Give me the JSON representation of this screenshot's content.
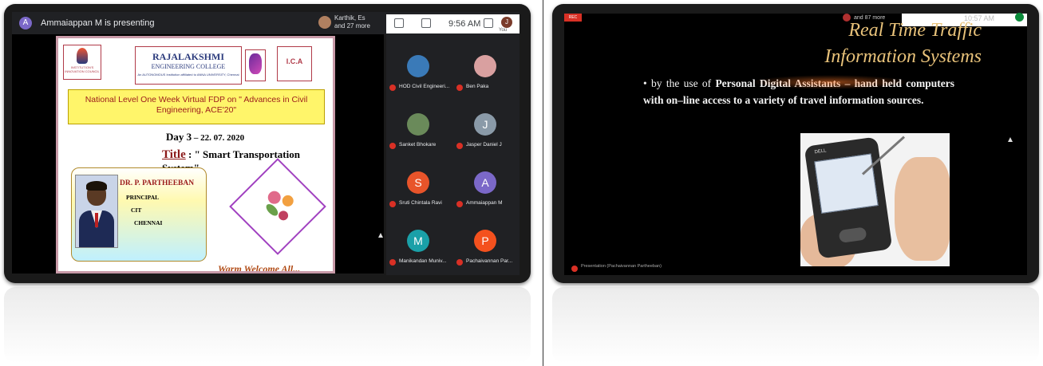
{
  "left_screen": {
    "presenter_initial": "A",
    "presenter_banner": "Ammaiappan M is presenting",
    "people_line1": "Karthik, Es",
    "people_line2": "and 27 more",
    "meeting_time": "9:56 AM",
    "self_initial": "J",
    "self_label": "You",
    "slide": {
      "logo_iic": "INSTITUTION'S INNOVATION COUNCIL",
      "college_name_1": "RAJALAKSHMI",
      "college_name_2": "ENGINEERING COLLEGE",
      "college_affiliation": "An AUTONOMOUS Institution affiliated to ANNA UNIVERSITY, Chennai",
      "logo_ica": "I.C.A",
      "banner": "National Level One Week Virtual FDP on \" Advances in Civil  Engineering, ACE'20\"",
      "day_label": "Day 3",
      "day_date": " – 22. 07. 2020",
      "title_word": "Title",
      "title_text": " : \" Smart Transportation System\"",
      "speaker_name": "DR. P. PARTHEEBAN",
      "speaker_role": "PRINCIPAL",
      "speaker_org": "CIT",
      "speaker_city": "CHENNAI",
      "welcome": "Warm Welcome All..."
    },
    "participants": [
      {
        "name": "HOD Civil Engineeri...",
        "initial": "",
        "color": "#3a7ab8"
      },
      {
        "name": "Ben Paka",
        "initial": "",
        "color": "#d9a0a0"
      },
      {
        "name": "Sanket Bhokare",
        "initial": "",
        "color": "#6a8a5a"
      },
      {
        "name": "Jasper Daniel J",
        "initial": "J",
        "color": "#8a9aa8"
      },
      {
        "name": "Sruti Chintala Ravi",
        "initial": "S",
        "color": "#e8542a"
      },
      {
        "name": "Ammaiappan M",
        "initial": "A",
        "color": "#7b68c8"
      },
      {
        "name": "Manikandan Muniv...",
        "initial": "M",
        "color": "#1aa0a8"
      },
      {
        "name": "Pachaivannan Par...",
        "initial": "P",
        "color": "#f4511e"
      }
    ]
  },
  "right_screen": {
    "rec_label": "REC",
    "people_label": "and 87 more",
    "meeting_time": "10:57 AM",
    "slide_title_line1": "Real Time Traffic",
    "slide_title_line2": "Information Systems",
    "bullet_prefix": "• by the use of ",
    "bullet_highlight": "Personal Digital Assistants",
    "bullet_rest": " – hand held computers with on–line access to a variety of travel information sources.",
    "device_brand": "DELL",
    "bottom_label": "Presentation (Pachaivannan Partheeban)"
  }
}
